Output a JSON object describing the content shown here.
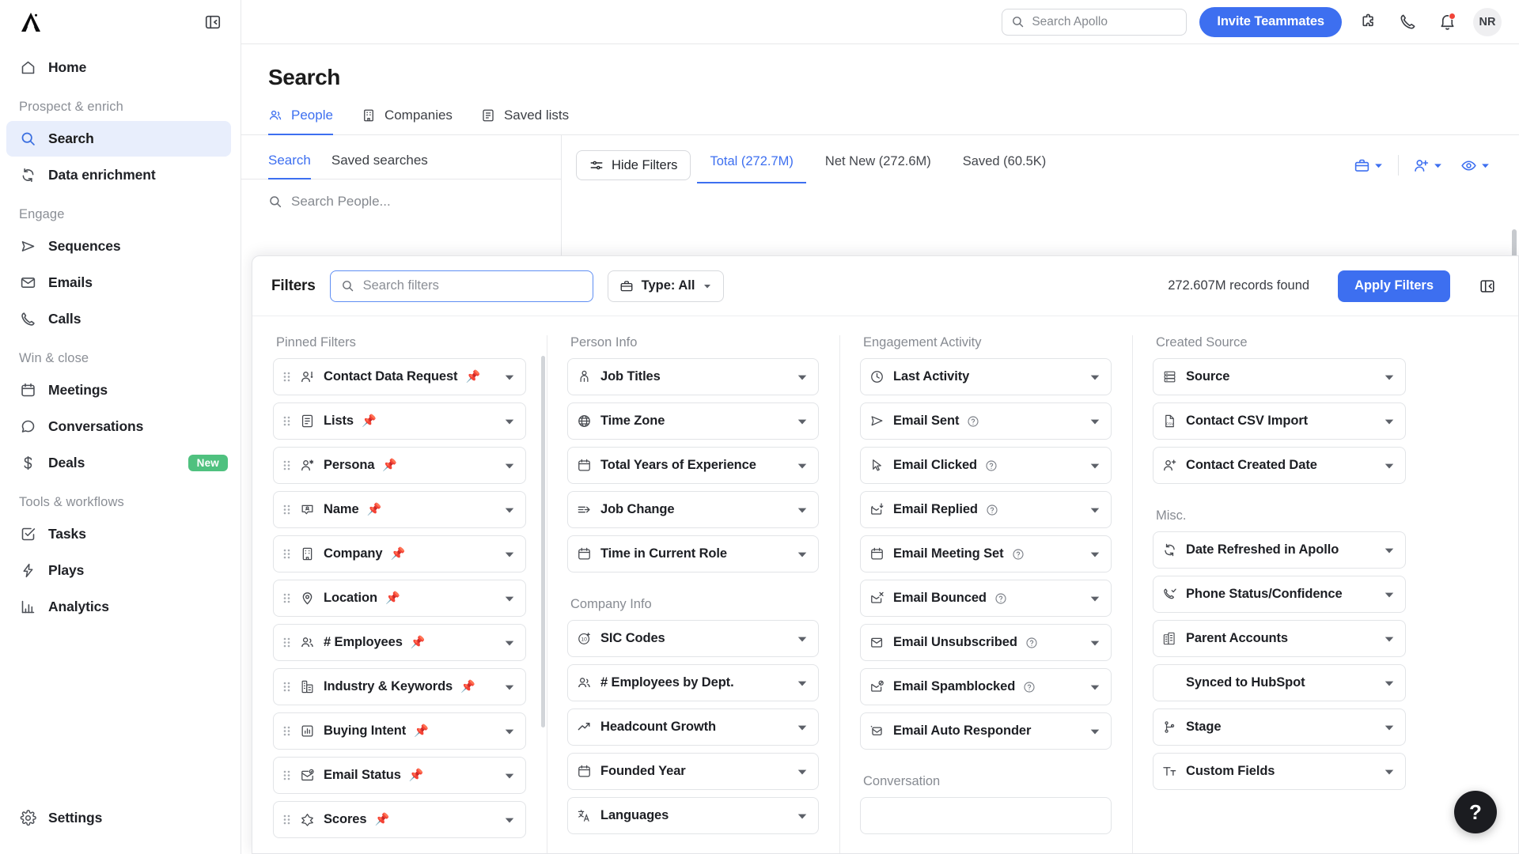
{
  "sidebar": {
    "logo_name": "apollo-logo",
    "items": [
      {
        "label": "Home",
        "icon": "home-icon",
        "type": "item",
        "active": false
      },
      {
        "label": "Prospect & enrich",
        "type": "group"
      },
      {
        "label": "Search",
        "icon": "search-icon",
        "type": "item",
        "active": true
      },
      {
        "label": "Data enrichment",
        "icon": "data-enrichment-icon",
        "type": "item",
        "active": false
      },
      {
        "label": "Engage",
        "type": "group"
      },
      {
        "label": "Sequences",
        "icon": "send-icon",
        "type": "item",
        "active": false
      },
      {
        "label": "Emails",
        "icon": "envelope-icon",
        "type": "item",
        "active": false
      },
      {
        "label": "Calls",
        "icon": "phone-icon",
        "type": "item",
        "active": false
      },
      {
        "label": "Win & close",
        "type": "group"
      },
      {
        "label": "Meetings",
        "icon": "calendar-icon",
        "type": "item",
        "active": false
      },
      {
        "label": "Conversations",
        "icon": "chat-bubble-icon",
        "type": "item",
        "active": false
      },
      {
        "label": "Deals",
        "icon": "dollar-icon",
        "type": "item",
        "active": false,
        "badge": "New"
      },
      {
        "label": "Tools & workflows",
        "type": "group"
      },
      {
        "label": "Tasks",
        "icon": "check-square-icon",
        "type": "item",
        "active": false
      },
      {
        "label": "Plays",
        "icon": "lightning-icon",
        "type": "item",
        "active": false
      },
      {
        "label": "Analytics",
        "icon": "bar-chart-icon",
        "type": "item",
        "active": false
      }
    ],
    "settings_label": "Settings"
  },
  "topbar": {
    "search_placeholder": "Search Apollo",
    "invite_label": "Invite Teammates",
    "avatar_initials": "NR"
  },
  "page": {
    "title": "Search",
    "tabs": [
      {
        "label": "People",
        "icon": "people-icon",
        "active": true
      },
      {
        "label": "Companies",
        "icon": "building-icon",
        "active": false
      },
      {
        "label": "Saved lists",
        "icon": "list-icon",
        "active": false
      }
    ]
  },
  "left_panel": {
    "tabs": [
      {
        "label": "Search",
        "active": true
      },
      {
        "label": "Saved searches",
        "active": false
      }
    ],
    "search_placeholder": "Search People..."
  },
  "results_toolbar": {
    "hide_filters_label": "Hide Filters",
    "count_tabs": [
      {
        "label": "Total (272.7M)",
        "active": true
      },
      {
        "label": "Net New (272.6M)",
        "active": false
      },
      {
        "label": "Saved (60.5K)",
        "active": false
      }
    ],
    "icons": [
      "briefcase-icon",
      "add-person-icon",
      "eye-icon"
    ]
  },
  "filters_panel": {
    "title": "Filters",
    "search_placeholder": "Search filters",
    "type_label": "Type: All",
    "records_found": "272.607M records found",
    "apply_label": "Apply Filters",
    "collapse_icon": "collapse-panel-icon",
    "columns": [
      {
        "key": "pinned",
        "groups": [
          {
            "label": "Pinned Filters",
            "items": [
              {
                "label": "Contact Data Request",
                "icon": "person-alert-icon",
                "pinned": true
              },
              {
                "label": "Lists",
                "icon": "list-icon",
                "pinned": true
              },
              {
                "label": "Persona",
                "icon": "person-star-icon",
                "pinned": true
              },
              {
                "label": "Name",
                "icon": "name-tag-icon",
                "pinned": true
              },
              {
                "label": "Company",
                "icon": "building-icon",
                "pinned": true
              },
              {
                "label": "Location",
                "icon": "map-pin-icon",
                "pinned": true
              },
              {
                "label": "# Employees",
                "icon": "people-icon",
                "pinned": true
              },
              {
                "label": "Industry & Keywords",
                "icon": "factory-icon",
                "pinned": true
              },
              {
                "label": "Buying Intent",
                "icon": "bar-chart-box-icon",
                "pinned": true
              },
              {
                "label": "Email Status",
                "icon": "email-check-icon",
                "pinned": true
              },
              {
                "label": "Scores",
                "icon": "diamond-icon",
                "pinned": true
              }
            ]
          }
        ]
      },
      {
        "key": "person",
        "groups": [
          {
            "label": "Person Info",
            "items": [
              {
                "label": "Job Titles",
                "icon": "briefcase-person-icon"
              },
              {
                "label": "Time Zone",
                "icon": "globe-icon"
              },
              {
                "label": "Total Years of Experience",
                "icon": "calendar-icon"
              },
              {
                "label": "Job Change",
                "icon": "arrow-right-lines-icon"
              },
              {
                "label": "Time in Current Role",
                "icon": "calendar-icon"
              }
            ]
          },
          {
            "label": "Company Info",
            "items": [
              {
                "label": "SIC Codes",
                "icon": "sic-code-icon"
              },
              {
                "label": "# Employees by Dept.",
                "icon": "people-icon"
              },
              {
                "label": "Headcount Growth",
                "icon": "trend-up-icon"
              },
              {
                "label": "Founded Year",
                "icon": "calendar-icon"
              },
              {
                "label": "Languages",
                "icon": "translate-icon"
              }
            ]
          }
        ]
      },
      {
        "key": "engage",
        "groups": [
          {
            "label": "Engagement Activity",
            "items": [
              {
                "label": "Last Activity",
                "icon": "clock-icon"
              },
              {
                "label": "Email Sent",
                "icon": "paper-plane-icon",
                "help": true
              },
              {
                "label": "Email Clicked",
                "icon": "cursor-icon",
                "help": true
              },
              {
                "label": "Email Replied",
                "icon": "email-reply-icon",
                "help": true
              },
              {
                "label": "Email Meeting Set",
                "icon": "calendar-icon",
                "help": true
              },
              {
                "label": "Email Bounced",
                "icon": "email-x-icon",
                "help": true
              },
              {
                "label": "Email Unsubscribed",
                "icon": "email-open-icon",
                "help": true
              },
              {
                "label": "Email Spamblocked",
                "icon": "email-block-icon",
                "help": true
              },
              {
                "label": "Email Auto Responder",
                "icon": "email-auto-icon"
              }
            ]
          },
          {
            "label": "Conversation",
            "items": []
          }
        ]
      },
      {
        "key": "created",
        "groups": [
          {
            "label": "Created Source",
            "items": [
              {
                "label": "Source",
                "icon": "server-icon"
              },
              {
                "label": "Contact CSV Import",
                "icon": "csv-file-icon"
              },
              {
                "label": "Contact Created Date",
                "icon": "add-person-icon"
              }
            ]
          },
          {
            "label": "Misc.",
            "items": [
              {
                "label": "Date Refreshed in Apollo",
                "icon": "refresh-icon"
              },
              {
                "label": "Phone Status/Confidence",
                "icon": "phone-check-icon"
              },
              {
                "label": "Parent Accounts",
                "icon": "buildings-icon"
              },
              {
                "label": "Synced to HubSpot",
                "icon": "none"
              },
              {
                "label": "Stage",
                "icon": "branch-icon"
              },
              {
                "label": "Custom Fields",
                "icon": "text-size-icon"
              }
            ]
          }
        ]
      }
    ]
  },
  "help_fab": {
    "label": "?",
    "icon": "help-icon"
  },
  "colors": {
    "accent": "#3d6ff0",
    "badge_new": "#4fc17f",
    "pin": "#f2c14b",
    "notification": "#f04438"
  }
}
